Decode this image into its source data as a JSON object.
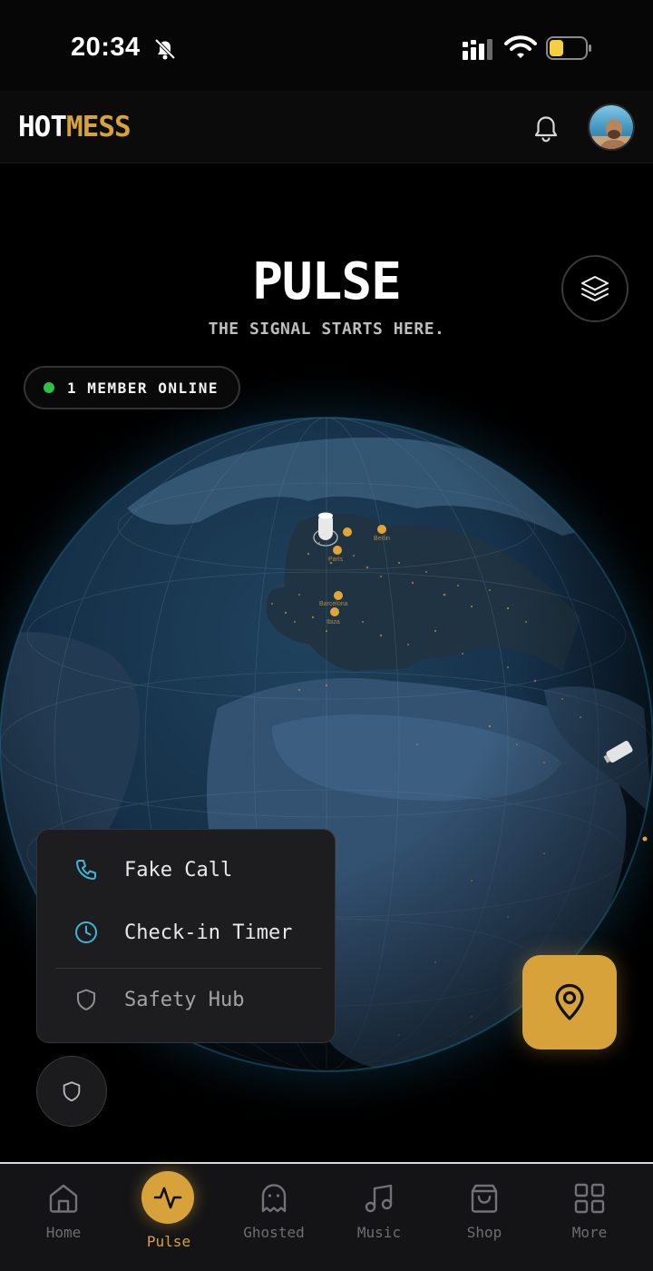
{
  "status_bar": {
    "time": "20:34"
  },
  "header": {
    "logo_part1": "HOT",
    "logo_part2": "MESS"
  },
  "pulse": {
    "title": "PULSE",
    "subtitle": "THE SIGNAL STARTS HERE.",
    "online_text": "1 MEMBER ONLINE"
  },
  "map": {
    "cities": [
      "Paris",
      "Berlin",
      "Barcelona",
      "Ibiza"
    ]
  },
  "safety_menu": {
    "items": [
      {
        "label": "Fake Call",
        "icon": "phone-icon"
      },
      {
        "label": "Check-in Timer",
        "icon": "clock-icon"
      },
      {
        "label": "Safety Hub",
        "icon": "shield-icon"
      }
    ]
  },
  "nav": {
    "items": [
      {
        "label": "Home",
        "icon": "home-icon"
      },
      {
        "label": "Pulse",
        "icon": "pulse-icon",
        "active": true
      },
      {
        "label": "Ghosted",
        "icon": "ghost-icon"
      },
      {
        "label": "Music",
        "icon": "music-icon"
      },
      {
        "label": "Shop",
        "icon": "shopping-bag-icon"
      },
      {
        "label": "More",
        "icon": "grid-icon"
      }
    ]
  },
  "colors": {
    "accent": "#d7a23a",
    "online": "#2fc145",
    "menu_icon": "#3fb6d6",
    "background": "#000000"
  }
}
